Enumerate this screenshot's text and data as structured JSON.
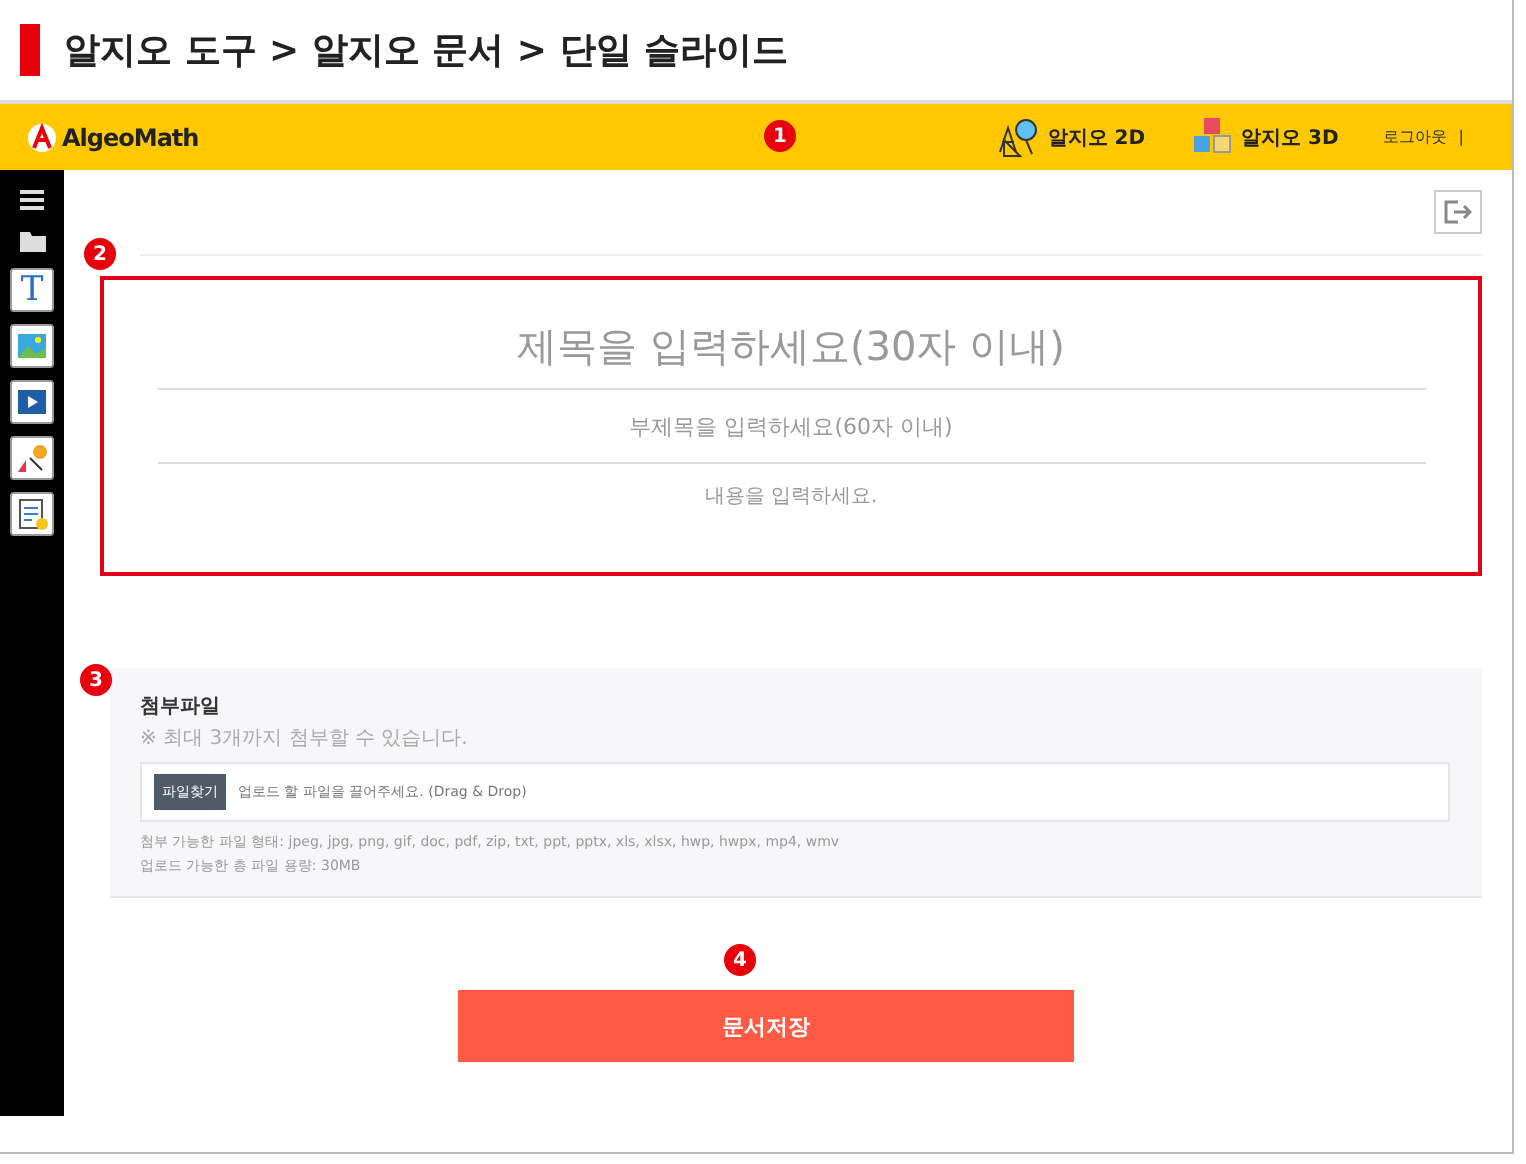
{
  "title": "알지오 도구 > 알지오 문서 > 단일 슬라이드",
  "header": {
    "logo": "AlgeoMath",
    "links": [
      {
        "label": "알지오 2D",
        "kind": "planar"
      },
      {
        "label": "알지오 3D",
        "kind": "spatial"
      }
    ],
    "logout": "로그아웃",
    "divider": "|"
  },
  "markers": [
    "1",
    "2",
    "3",
    "4"
  ],
  "sidebar": {
    "text_tool": "T"
  },
  "editor": {
    "title_placeholder": "제목을 입력하세요(30자 이내)",
    "subtitle_placeholder": "부제목을 입력하세요(60자 이내)",
    "content_placeholder": "내용을 입력하세요.",
    "highlighted": true
  },
  "attachment": {
    "heading": "첨부파일",
    "note": "※ 최대 3개까지 첨부할 수 있습니다.",
    "button": "파일찾기",
    "placeholder": "업로드 할 파일을 끌어주세요. (Drag & Drop)",
    "types": "첨부 가능한 파일 형태: jpeg, jpg, png, gif, doc, pdf, zip, txt, ppt, pptx, xls, xlsx, hwp, hwpx, mp4, wmv",
    "limit": "업로드 가능한 총 파일 용량: 30MB"
  },
  "save_button": "문서저장"
}
